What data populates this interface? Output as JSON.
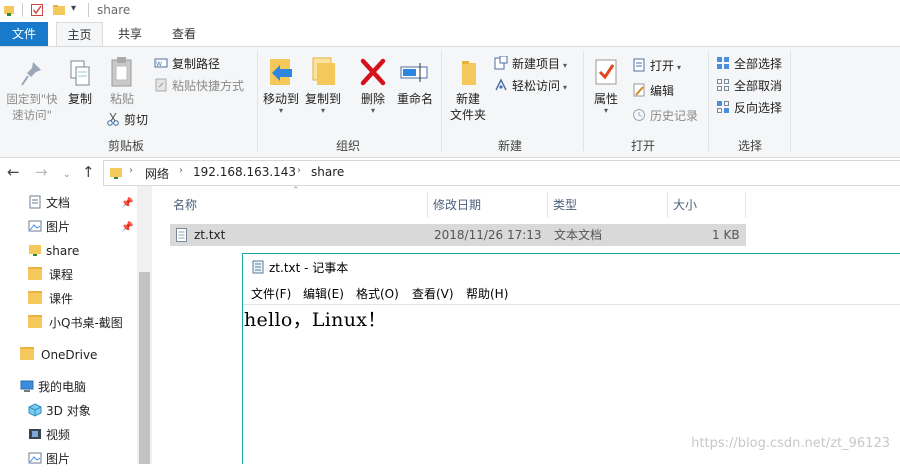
{
  "window": {
    "title": "share"
  },
  "ribbon_tabs": {
    "file": "文件",
    "home": "主页",
    "share": "共享",
    "view": "查看"
  },
  "ribbon": {
    "clipboard": {
      "label": "剪贴板",
      "pin_quick_access": "固定到\"快\n速访问\"",
      "copy": "复制",
      "paste": "粘贴",
      "copy_path": "复制路径",
      "paste_shortcut": "粘贴快捷方式",
      "cut": "剪切"
    },
    "organize": {
      "label": "组织",
      "move_to": "移动到",
      "copy_to": "复制到",
      "delete": "删除",
      "rename": "重命名"
    },
    "new": {
      "label": "新建",
      "new_folder": "新建\n文件夹",
      "new_item": "新建项目",
      "easy_access": "轻松访问"
    },
    "open": {
      "label": "打开",
      "properties": "属性",
      "open": "打开",
      "edit": "编辑",
      "history": "历史记录"
    },
    "select": {
      "label": "选择",
      "select_all": "全部选择",
      "select_none": "全部取消",
      "invert": "反向选择"
    }
  },
  "address": {
    "crumbs": [
      "网络",
      "192.168.163.143",
      "share"
    ]
  },
  "nav_pane": {
    "items": [
      "文档",
      "图片",
      "share",
      "课程",
      "课件",
      "小Q书桌-截图",
      "OneDrive",
      "我的电脑",
      "3D 对象",
      "视频",
      "图片"
    ]
  },
  "file_list": {
    "columns": [
      "名称",
      "修改日期",
      "类型",
      "大小"
    ],
    "rows": [
      {
        "name": "zt.txt",
        "modified": "2018/11/26 17:13",
        "type": "文本文档",
        "size": "1 KB"
      }
    ]
  },
  "notepad": {
    "title": "zt.txt - 记事本",
    "menu": [
      "文件(F)",
      "编辑(E)",
      "格式(O)",
      "查看(V)",
      "帮助(H)"
    ],
    "content": "hello，Linux！"
  },
  "watermark": "https://blog.csdn.net/zt_96123",
  "colors": {
    "accent": "#1979ca",
    "selection": "#d9d9d9",
    "notepad_border": "#15a8a0"
  }
}
